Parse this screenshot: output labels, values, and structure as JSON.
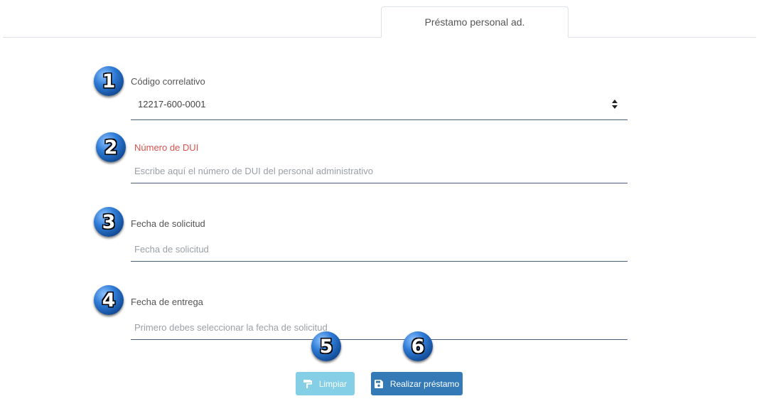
{
  "tabs": [
    {
      "label": "Préstamo personal ad.",
      "active": true
    }
  ],
  "markers": [
    "1",
    "2",
    "3",
    "4",
    "5",
    "6"
  ],
  "form": {
    "codigo": {
      "label": "Código correlativo",
      "value": "12217-600-0001"
    },
    "dui": {
      "label": "Número de DUI",
      "placeholder": "Escribe aquí el número de DUI del personal administrativo",
      "state": "error"
    },
    "fecha_solicitud": {
      "label": "Fecha de solicitud",
      "placeholder": "Fecha de solicitud"
    },
    "fecha_entrega": {
      "label": "Fecha de entrega",
      "placeholder": "Primero debes seleccionar la fecha de solicitud"
    }
  },
  "buttons": {
    "clear": {
      "label": "Limpiar",
      "icon": "paint-roller-icon",
      "color": "#5bc0de",
      "disabled": true
    },
    "submit": {
      "label": "Realizar préstamo",
      "icon": "save-icon",
      "color": "#337ab7"
    }
  },
  "colors": {
    "error": "#d9534f",
    "badge": "#2e7bd6"
  }
}
